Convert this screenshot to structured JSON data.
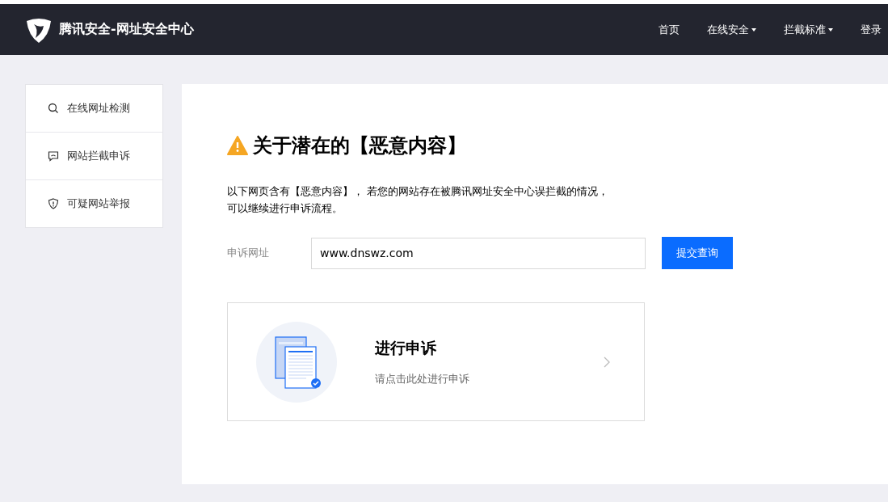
{
  "header": {
    "brand": "腾讯安全-网址安全中心",
    "nav": [
      {
        "label": "首页",
        "dropdown": false
      },
      {
        "label": "在线安全",
        "dropdown": true
      },
      {
        "label": "拦截标准",
        "dropdown": true
      },
      {
        "label": "登录",
        "dropdown": false
      }
    ]
  },
  "sidebar": {
    "items": [
      {
        "kind": "search",
        "label": "在线网址检测"
      },
      {
        "kind": "message",
        "label": "网站拦截申诉"
      },
      {
        "kind": "shield",
        "label": "可疑网站举报"
      }
    ]
  },
  "main": {
    "title": "关于潜在的【恶意内容】",
    "description_lines": [
      "以下网页含有【恶意内容】， 若您的网站存在被腾讯网址安全中心误拦截的情况，",
      "可以继续进行申诉流程。"
    ],
    "form": {
      "label": "申诉网址",
      "value": "www.dnswz.com",
      "button": "提交查询"
    },
    "card": {
      "title": "进行申诉",
      "subtitle": "请点击此处进行申诉"
    }
  }
}
